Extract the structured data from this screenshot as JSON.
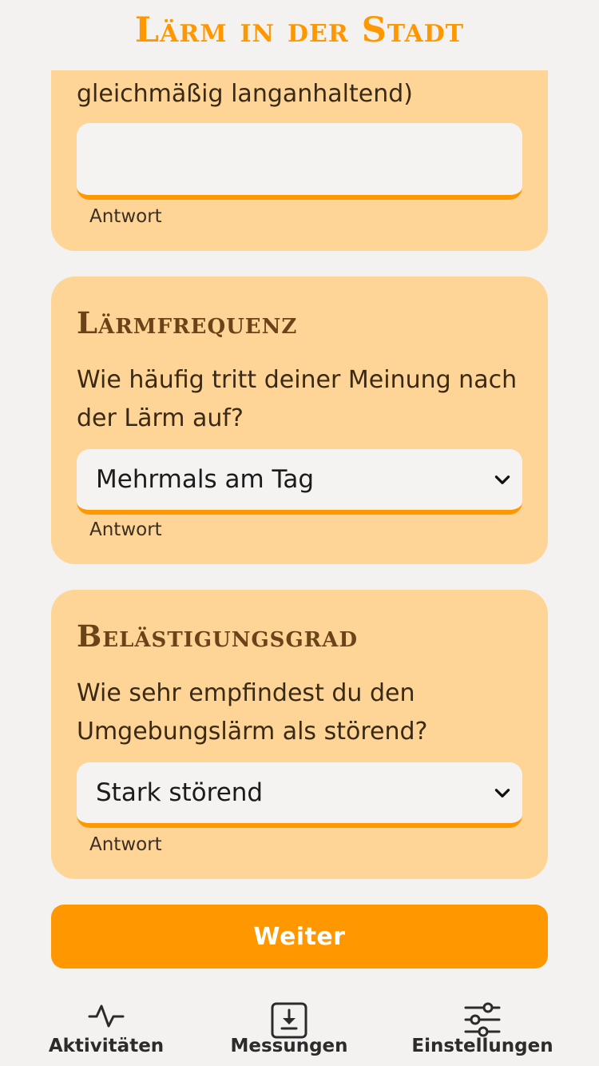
{
  "app": {
    "title": "Lärm in der Stadt"
  },
  "sections": [
    {
      "question_tail": "gleichmäßig langanhaltend)",
      "input_value": "",
      "helper": "Antwort"
    },
    {
      "title": "Lärmfrequenz",
      "question": "Wie häufig tritt deiner Meinung nach der Lärm auf?",
      "selected": "Mehrmals am Tag",
      "helper": "Antwort"
    },
    {
      "title": "Belästigungsgrad",
      "question": "Wie sehr empfindest du den Umgebungslärm als störend?",
      "selected": "Stark störend",
      "helper": "Antwort"
    }
  ],
  "actions": {
    "next_label": "Weiter"
  },
  "nav": {
    "items": [
      {
        "label": "Aktivitäten",
        "icon": "activity-icon"
      },
      {
        "label": "Messungen",
        "icon": "download-box-icon"
      },
      {
        "label": "Einstellungen",
        "icon": "sliders-icon"
      }
    ]
  },
  "colors": {
    "accent": "#ff9800",
    "card_background": "#ffd597",
    "title_brown": "#6b4318",
    "page_background": "#f4f2f0"
  }
}
